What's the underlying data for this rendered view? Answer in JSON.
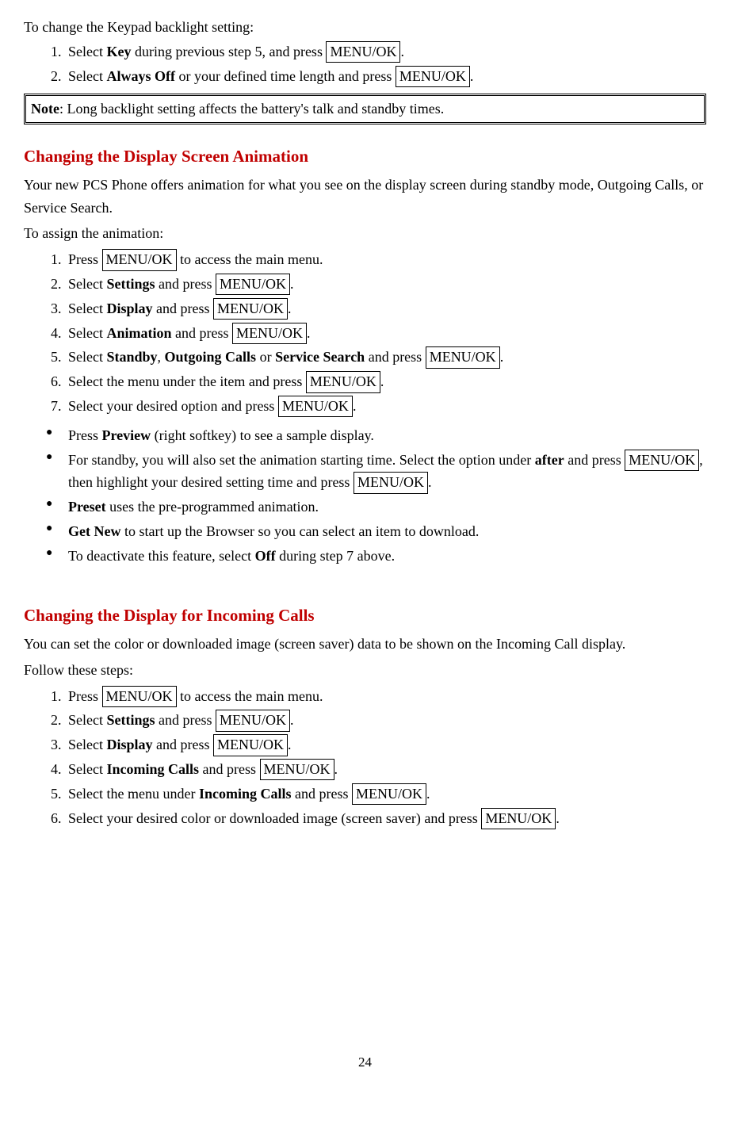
{
  "keypad": {
    "intro": "To change the Keypad backlight setting:",
    "steps": [
      {
        "pre": "Select ",
        "b1": "Key",
        "mid": " during previous step 5, and press ",
        "btn": "MENU/OK",
        "post": "."
      },
      {
        "pre": "Select ",
        "b1": "Always Off",
        "mid": " or your defined time length and press ",
        "btn": "MENU/OK",
        "post": "."
      }
    ],
    "note_label": "Note",
    "note_text": ": Long backlight setting affects the battery's talk and standby times."
  },
  "animation": {
    "heading": "Changing the Display Screen Animation",
    "intro": "Your new PCS Phone offers animation for what you see on the display screen during standby mode, Outgoing Calls, or Service Search.",
    "assign": "To assign the animation:",
    "steps": [
      {
        "pre": "Press ",
        "btn": "MENU/OK",
        "post": " to access the main menu."
      },
      {
        "pre": "Select ",
        "b1": "Settings",
        "mid": " and press ",
        "btn": "MENU/OK",
        "post": "."
      },
      {
        "pre": "Select ",
        "b1": "Display",
        "mid": " and press ",
        "btn": "MENU/OK",
        "post": "."
      },
      {
        "pre": "Select ",
        "b1": "Animation",
        "mid": " and press ",
        "btn": "MENU/OK",
        "post": "."
      },
      {
        "pre": "Select ",
        "b1": "Standby",
        "sep1": ", ",
        "b2": "Outgoing Calls",
        "sep2": " or ",
        "b3": "Service Search",
        "mid": " and press ",
        "btn": "MENU/OK",
        "post": "."
      },
      {
        "pre": "Select the menu under the item and press ",
        "btn": "MENU/OK",
        "post": "."
      },
      {
        "pre": "Select your desired option and press ",
        "btn": "MENU/OK",
        "post": "."
      }
    ],
    "bullets": [
      {
        "pre": "Press ",
        "b1": "Preview",
        "post": " (right softkey) to see a sample display."
      },
      {
        "pre": "For standby, you will also set the animation starting time. Select the option under ",
        "b1": "after",
        "mid": " and press ",
        "btn1": "MENU/OK",
        "mid2": ", then highlight your desired setting time and press ",
        "btn2": "MENU/OK",
        "post": "."
      },
      {
        "b1": "Preset",
        "post": " uses the pre-programmed animation."
      },
      {
        "b1": "Get New",
        "post": " to start up the Browser so you can select an item to download."
      },
      {
        "pre": "To deactivate this feature, select ",
        "b1": "Off",
        "post": " during step 7 above."
      }
    ]
  },
  "incoming": {
    "heading": "Changing the Display for Incoming Calls",
    "intro": "You can set the color or downloaded image (screen saver) data to be shown on the Incoming Call display.",
    "follow": "Follow these steps:",
    "steps": [
      {
        "pre": "Press ",
        "btn": "MENU/OK",
        "post": " to access the main menu."
      },
      {
        "pre": "Select ",
        "b1": "Settings",
        "mid": " and press ",
        "btn": "MENU/OK",
        "post": "."
      },
      {
        "pre": "Select ",
        "b1": "Display",
        "mid": " and press ",
        "btn": "MENU/OK",
        "post": "."
      },
      {
        "pre": "Select ",
        "b1": "Incoming Calls",
        "mid": " and press ",
        "btn": "MENU/OK",
        "post": "."
      },
      {
        "pre": "Select the menu under ",
        "b1": "Incoming Calls",
        "mid": " and press ",
        "btn": "MENU/OK",
        "post": "."
      },
      {
        "pre": "Select your desired color or downloaded image (screen saver) and press ",
        "btn": "MENU/OK",
        "post": "."
      }
    ]
  },
  "page_number": "24"
}
